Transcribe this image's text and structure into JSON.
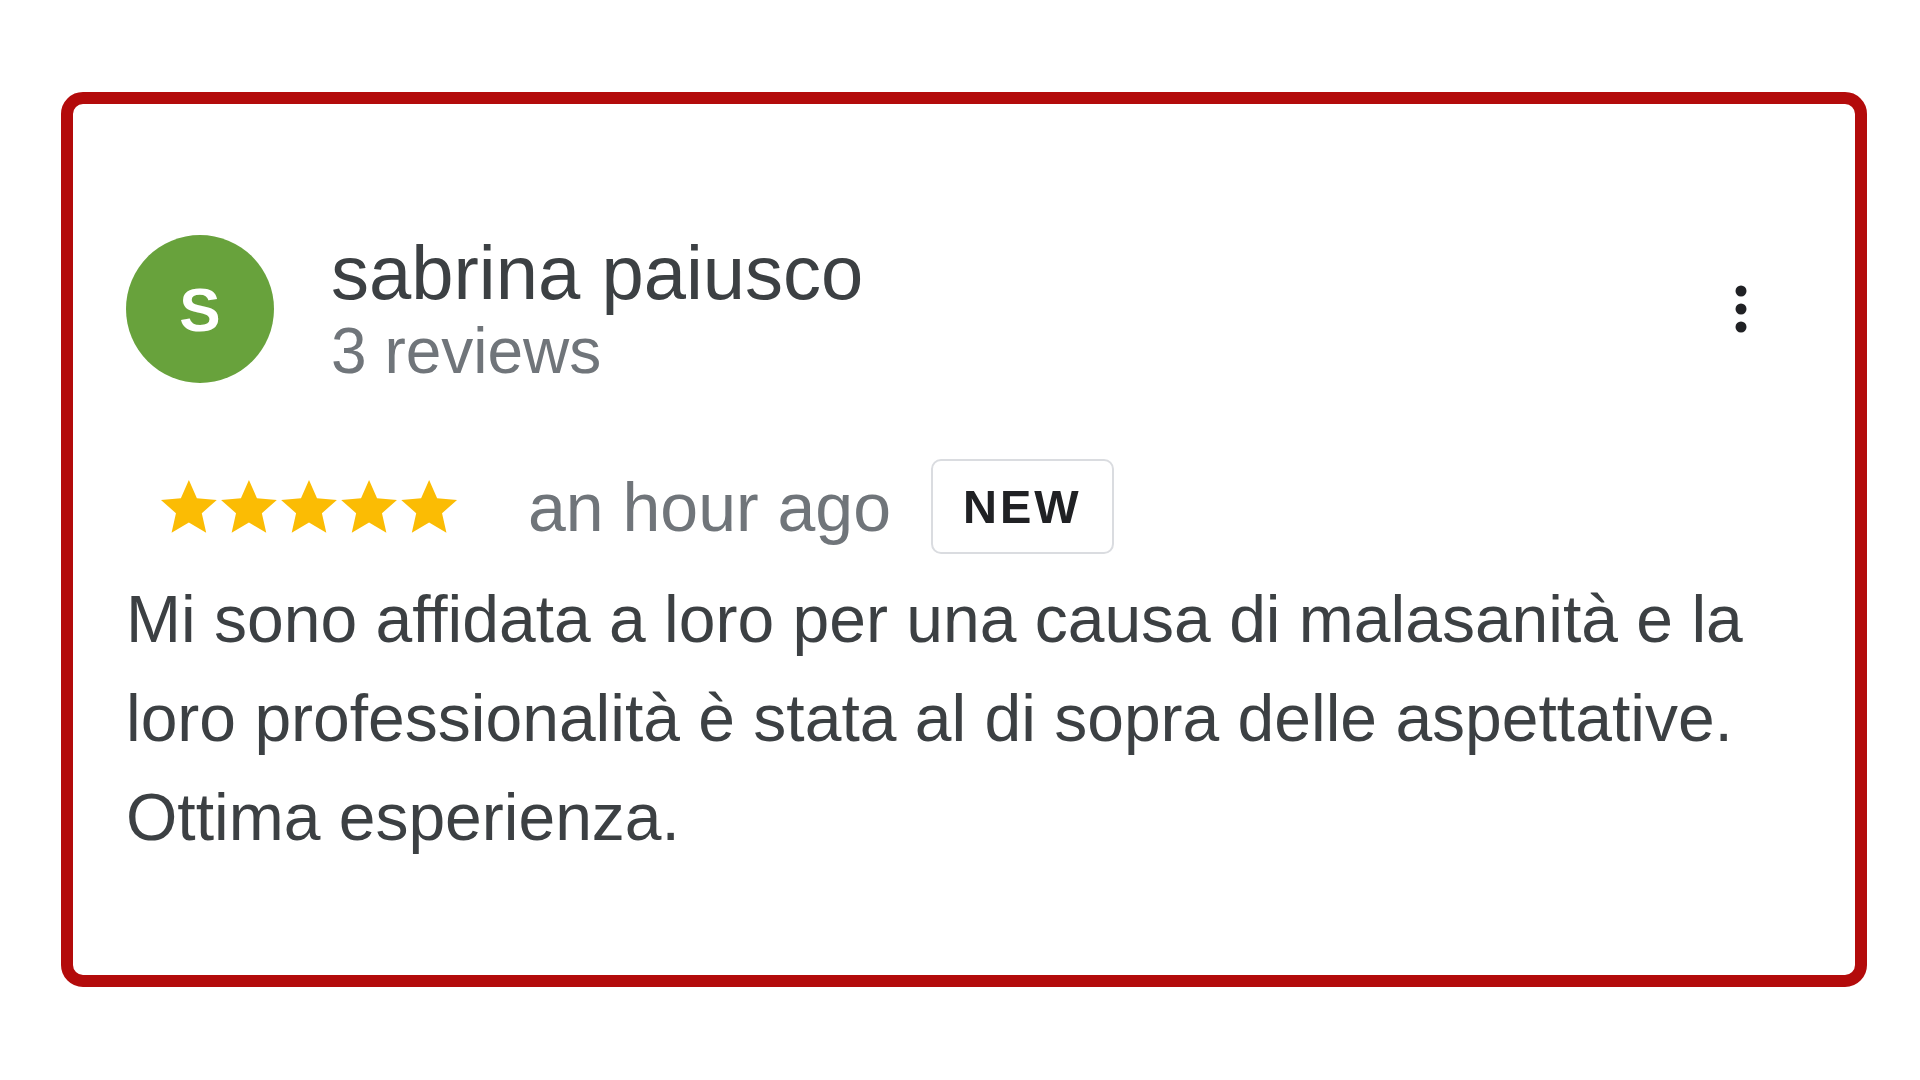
{
  "review": {
    "avatar_initial": "S",
    "name": "sabrina paiusco",
    "review_count": "3 reviews",
    "stars": 5,
    "time": "an hour ago",
    "badge": "NEW",
    "text": "Mi sono affidata a loro per una causa di malasanità e la loro professionalità è stata al di sopra delle aspettative. Ottima esperienza."
  }
}
